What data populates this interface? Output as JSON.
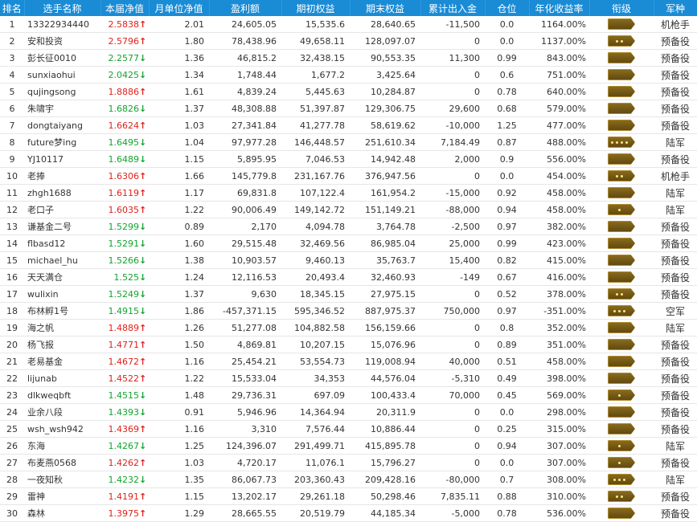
{
  "colors": {
    "header_bg": "#1a8bd5",
    "up": "#e0211b",
    "down": "#11a52e",
    "badge": "#6b511a"
  },
  "headers": [
    "排名",
    "选手名称",
    "本届净值",
    "月单位净值",
    "盈利额",
    "期初权益",
    "期末权益",
    "累计出入金",
    "仓位",
    "年化收益率",
    "衔级",
    "军种"
  ],
  "rows": [
    {
      "rank": "1",
      "name": "13322934440",
      "nav": "2.5838",
      "dir": "up",
      "monthly": "2.01",
      "profit": "24,605.05",
      "start": "15,535.6",
      "end": "28,640.65",
      "flow": "-11,500",
      "position": "0.0",
      "annual": "1164.00%",
      "rank_stars": 0,
      "branch": "机枪手"
    },
    {
      "rank": "2",
      "name": "安和投资",
      "nav": "2.5796",
      "dir": "up",
      "monthly": "1.80",
      "profit": "78,438.96",
      "start": "49,658.11",
      "end": "128,097.07",
      "flow": "0",
      "position": "0.0",
      "annual": "1137.00%",
      "rank_stars": 2,
      "branch": "预备役"
    },
    {
      "rank": "3",
      "name": "彭长征0010",
      "nav": "2.2577",
      "dir": "down",
      "monthly": "1.36",
      "profit": "46,815.2",
      "start": "32,438.15",
      "end": "90,553.35",
      "flow": "11,300",
      "position": "0.99",
      "annual": "843.00%",
      "rank_stars": 0,
      "branch": "预备役"
    },
    {
      "rank": "4",
      "name": "sunxiaohui",
      "nav": "2.0425",
      "dir": "down",
      "monthly": "1.34",
      "profit": "1,748.44",
      "start": "1,677.2",
      "end": "3,425.64",
      "flow": "0",
      "position": "0.6",
      "annual": "751.00%",
      "rank_stars": 0,
      "branch": "预备役"
    },
    {
      "rank": "5",
      "name": "qujingsong",
      "nav": "1.8886",
      "dir": "up",
      "monthly": "1.61",
      "profit": "4,839.24",
      "start": "5,445.63",
      "end": "10,284.87",
      "flow": "0",
      "position": "0.78",
      "annual": "640.00%",
      "rank_stars": 0,
      "branch": "预备役"
    },
    {
      "rank": "6",
      "name": "朱啸宇",
      "nav": "1.6826",
      "dir": "down",
      "monthly": "1.37",
      "profit": "48,308.88",
      "start": "51,397.87",
      "end": "129,306.75",
      "flow": "29,600",
      "position": "0.68",
      "annual": "579.00%",
      "rank_stars": 0,
      "branch": "预备役"
    },
    {
      "rank": "7",
      "name": "dongtaiyang",
      "nav": "1.6624",
      "dir": "up",
      "monthly": "1.03",
      "profit": "27,341.84",
      "start": "41,277.78",
      "end": "58,619.62",
      "flow": "-10,000",
      "position": "1.25",
      "annual": "477.00%",
      "rank_stars": 0,
      "branch": "预备役"
    },
    {
      "rank": "8",
      "name": "future梦ing",
      "nav": "1.6495",
      "dir": "down",
      "monthly": "1.04",
      "profit": "97,977.28",
      "start": "146,448.57",
      "end": "251,610.34",
      "flow": "7,184.49",
      "position": "0.87",
      "annual": "488.00%",
      "rank_stars": 4,
      "branch": "陆军"
    },
    {
      "rank": "9",
      "name": "YJ10117",
      "nav": "1.6489",
      "dir": "down",
      "monthly": "1.15",
      "profit": "5,895.95",
      "start": "7,046.53",
      "end": "14,942.48",
      "flow": "2,000",
      "position": "0.9",
      "annual": "556.00%",
      "rank_stars": 0,
      "branch": "预备役"
    },
    {
      "rank": "10",
      "name": "老捧",
      "nav": "1.6306",
      "dir": "up",
      "monthly": "1.66",
      "profit": "145,779.8",
      "start": "231,167.76",
      "end": "376,947.56",
      "flow": "0",
      "position": "0.0",
      "annual": "454.00%",
      "rank_stars": 2,
      "branch": "机枪手"
    },
    {
      "rank": "11",
      "name": "zhgh1688",
      "nav": "1.6119",
      "dir": "up",
      "monthly": "1.17",
      "profit": "69,831.8",
      "start": "107,122.4",
      "end": "161,954.2",
      "flow": "-15,000",
      "position": "0.92",
      "annual": "458.00%",
      "rank_stars": 0,
      "branch": "陆军"
    },
    {
      "rank": "12",
      "name": "老口子",
      "nav": "1.6035",
      "dir": "up",
      "monthly": "1.22",
      "profit": "90,006.49",
      "start": "149,142.72",
      "end": "151,149.21",
      "flow": "-88,000",
      "position": "0.94",
      "annual": "458.00%",
      "rank_stars": 1,
      "branch": "陆军"
    },
    {
      "rank": "13",
      "name": "谦基金二号",
      "nav": "1.5299",
      "dir": "down",
      "monthly": "0.89",
      "profit": "2,170",
      "start": "4,094.78",
      "end": "3,764.78",
      "flow": "-2,500",
      "position": "0.97",
      "annual": "382.00%",
      "rank_stars": 0,
      "branch": "预备役"
    },
    {
      "rank": "14",
      "name": "flbasd12",
      "nav": "1.5291",
      "dir": "down",
      "monthly": "1.60",
      "profit": "29,515.48",
      "start": "32,469.56",
      "end": "86,985.04",
      "flow": "25,000",
      "position": "0.99",
      "annual": "423.00%",
      "rank_stars": 0,
      "branch": "预备役"
    },
    {
      "rank": "15",
      "name": "michael_hu",
      "nav": "1.5266",
      "dir": "down",
      "monthly": "1.38",
      "profit": "10,903.57",
      "start": "9,460.13",
      "end": "35,763.7",
      "flow": "15,400",
      "position": "0.82",
      "annual": "415.00%",
      "rank_stars": 0,
      "branch": "预备役"
    },
    {
      "rank": "16",
      "name": "天天满仓",
      "nav": "1.525",
      "dir": "down",
      "monthly": "1.24",
      "profit": "12,116.53",
      "start": "20,493.4",
      "end": "32,460.93",
      "flow": "-149",
      "position": "0.67",
      "annual": "416.00%",
      "rank_stars": 0,
      "branch": "预备役"
    },
    {
      "rank": "17",
      "name": "wulixin",
      "nav": "1.5249",
      "dir": "down",
      "monthly": "1.37",
      "profit": "9,630",
      "start": "18,345.15",
      "end": "27,975.15",
      "flow": "0",
      "position": "0.52",
      "annual": "378.00%",
      "rank_stars": 2,
      "branch": "预备役"
    },
    {
      "rank": "18",
      "name": "布林孵1号",
      "nav": "1.4915",
      "dir": "down",
      "monthly": "1.86",
      "profit": "-457,371.15",
      "start": "595,346.52",
      "end": "887,975.37",
      "flow": "750,000",
      "position": "0.97",
      "annual": "-351.00%",
      "rank_stars": 3,
      "branch": "空军"
    },
    {
      "rank": "19",
      "name": "海之帆",
      "nav": "1.4889",
      "dir": "up",
      "monthly": "1.26",
      "profit": "51,277.08",
      "start": "104,882.58",
      "end": "156,159.66",
      "flow": "0",
      "position": "0.8",
      "annual": "352.00%",
      "rank_stars": 0,
      "branch": "陆军"
    },
    {
      "rank": "20",
      "name": "杨飞报",
      "nav": "1.4771",
      "dir": "up",
      "monthly": "1.50",
      "profit": "4,869.81",
      "start": "10,207.15",
      "end": "15,076.96",
      "flow": "0",
      "position": "0.89",
      "annual": "351.00%",
      "rank_stars": 0,
      "branch": "预备役"
    },
    {
      "rank": "21",
      "name": "老易基金",
      "nav": "1.4672",
      "dir": "up",
      "monthly": "1.16",
      "profit": "25,454.21",
      "start": "53,554.73",
      "end": "119,008.94",
      "flow": "40,000",
      "position": "0.51",
      "annual": "458.00%",
      "rank_stars": 0,
      "branch": "预备役"
    },
    {
      "rank": "22",
      "name": "lijunab",
      "nav": "1.4522",
      "dir": "up",
      "monthly": "1.22",
      "profit": "15,533.04",
      "start": "34,353",
      "end": "44,576.04",
      "flow": "-5,310",
      "position": "0.49",
      "annual": "398.00%",
      "rank_stars": 0,
      "branch": "预备役"
    },
    {
      "rank": "23",
      "name": "dlkweqbft",
      "nav": "1.4515",
      "dir": "down",
      "monthly": "1.48",
      "profit": "29,736.31",
      "start": "697.09",
      "end": "100,433.4",
      "flow": "70,000",
      "position": "0.45",
      "annual": "569.00%",
      "rank_stars": 1,
      "branch": "预备役"
    },
    {
      "rank": "24",
      "name": "业余八段",
      "nav": "1.4393",
      "dir": "down",
      "monthly": "0.91",
      "profit": "5,946.96",
      "start": "14,364.94",
      "end": "20,311.9",
      "flow": "0",
      "position": "0.0",
      "annual": "298.00%",
      "rank_stars": 0,
      "branch": "预备役"
    },
    {
      "rank": "25",
      "name": "wsh_wsh942",
      "nav": "1.4369",
      "dir": "up",
      "monthly": "1.16",
      "profit": "3,310",
      "start": "7,576.44",
      "end": "10,886.44",
      "flow": "0",
      "position": "0.25",
      "annual": "315.00%",
      "rank_stars": 0,
      "branch": "预备役"
    },
    {
      "rank": "26",
      "name": "东海",
      "nav": "1.4267",
      "dir": "down",
      "monthly": "1.25",
      "profit": "124,396.07",
      "start": "291,499.71",
      "end": "415,895.78",
      "flow": "0",
      "position": "0.94",
      "annual": "307.00%",
      "rank_stars": 1,
      "branch": "陆军"
    },
    {
      "rank": "27",
      "name": "布麦燕0568",
      "nav": "1.4262",
      "dir": "up",
      "monthly": "1.03",
      "profit": "4,720.17",
      "start": "11,076.1",
      "end": "15,796.27",
      "flow": "0",
      "position": "0.0",
      "annual": "307.00%",
      "rank_stars": 1,
      "branch": "预备役"
    },
    {
      "rank": "28",
      "name": "一夜知秋",
      "nav": "1.4232",
      "dir": "down",
      "monthly": "1.35",
      "profit": "86,067.73",
      "start": "203,360.43",
      "end": "209,428.16",
      "flow": "-80,000",
      "position": "0.7",
      "annual": "308.00%",
      "rank_stars": 3,
      "branch": "陆军"
    },
    {
      "rank": "29",
      "name": "雷神",
      "nav": "1.4191",
      "dir": "up",
      "monthly": "1.15",
      "profit": "13,202.17",
      "start": "29,261.18",
      "end": "50,298.46",
      "flow": "7,835.11",
      "position": "0.88",
      "annual": "310.00%",
      "rank_stars": 2,
      "branch": "预备役"
    },
    {
      "rank": "30",
      "name": "森林",
      "nav": "1.3975",
      "dir": "up",
      "monthly": "1.29",
      "profit": "28,665.55",
      "start": "20,519.79",
      "end": "44,185.34",
      "flow": "-5,000",
      "position": "0.78",
      "annual": "536.00%",
      "rank_stars": 0,
      "branch": "预备役"
    }
  ]
}
